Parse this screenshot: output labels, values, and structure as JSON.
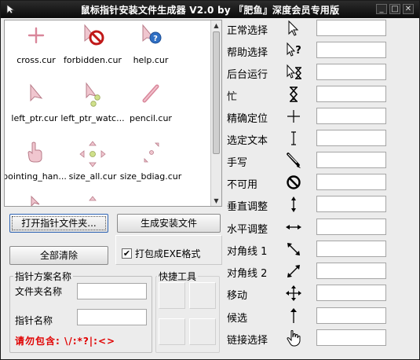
{
  "window": {
    "title": "鼠标指针安装文件生成器 V2.0  by 『肥鱼』深度会员专用版",
    "minimize_glyph": "_",
    "maximize_glyph": "□",
    "close_glyph": "✕"
  },
  "file_list": {
    "items": [
      {
        "name": "cross.cur",
        "icon": "cross-cursor-icon"
      },
      {
        "name": "forbidden.cur",
        "icon": "forbidden-cursor-icon"
      },
      {
        "name": "help.cur",
        "icon": "help-cursor-icon"
      },
      {
        "name": "left_ptr.cur",
        "icon": "left-pointer-cursor-icon"
      },
      {
        "name": "left_ptr_watc...",
        "icon": "left-pointer-watch-cursor-icon"
      },
      {
        "name": "pencil.cur",
        "icon": "pencil-cursor-icon"
      },
      {
        "name": "pointing_han...",
        "icon": "pointing-hand-cursor-icon"
      },
      {
        "name": "size_all.cur",
        "icon": "size-all-cursor-icon"
      },
      {
        "name": "size_bdiag.cur",
        "icon": "size-bdiag-cursor-icon"
      }
    ]
  },
  "buttons": {
    "open_folder": "打开指针文件夹...",
    "generate": "生成安装文件",
    "clear_all": "全部清除"
  },
  "options": {
    "pack_exe_label": "打包成EXE格式",
    "pack_exe_checked": true
  },
  "scheme_group": {
    "title": "指针方案名称",
    "folder_name_label": "文件夹名称",
    "folder_name_value": "",
    "pointer_name_label": "指针名称",
    "pointer_name_value": "",
    "warning": "请勿包含: \\/:*?|:<>"
  },
  "tools_group": {
    "title": "快捷工具"
  },
  "cursor_roles": [
    {
      "label": "正常选择",
      "icon": "arrow-cursor-icon",
      "value": ""
    },
    {
      "label": "帮助选择",
      "icon": "help-select-cursor-icon",
      "value": ""
    },
    {
      "label": "后台运行",
      "icon": "working-background-cursor-icon",
      "value": ""
    },
    {
      "label": "忙",
      "icon": "busy-hourglass-icon",
      "value": ""
    },
    {
      "label": "精确定位",
      "icon": "precision-cross-icon",
      "value": ""
    },
    {
      "label": "选定文本",
      "icon": "text-beam-icon",
      "value": ""
    },
    {
      "label": "手写",
      "icon": "handwriting-pen-icon",
      "value": ""
    },
    {
      "label": "不可用",
      "icon": "unavailable-icon",
      "value": ""
    },
    {
      "label": "垂直调整",
      "icon": "vertical-resize-icon",
      "value": ""
    },
    {
      "label": "水平调整",
      "icon": "horizontal-resize-icon",
      "value": ""
    },
    {
      "label": "对角线 1",
      "icon": "diagonal-resize-1-icon",
      "value": ""
    },
    {
      "label": "对角线 2",
      "icon": "diagonal-resize-2-icon",
      "value": ""
    },
    {
      "label": "移动",
      "icon": "move-icon",
      "value": ""
    },
    {
      "label": "候选",
      "icon": "alternate-select-icon",
      "value": ""
    },
    {
      "label": "链接选择",
      "icon": "link-hand-icon",
      "value": ""
    }
  ]
}
